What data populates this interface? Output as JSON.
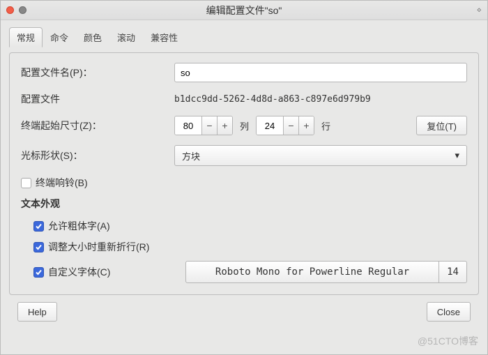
{
  "window": {
    "title": "编辑配置文件\"so\""
  },
  "tabs": [
    "常规",
    "命令",
    "颜色",
    "滚动",
    "兼容性"
  ],
  "form": {
    "profile_name": {
      "label": "配置文件名(P)：",
      "value": "so"
    },
    "profile_id": {
      "label": "配置文件",
      "value": "b1dcc9dd-5262-4d8d-a863-c897e6d979b9"
    },
    "initial_size": {
      "label": "终端起始尺寸(Z)：",
      "cols": "80",
      "cols_unit": "列",
      "rows": "24",
      "rows_unit": "行",
      "reset_label": "复位(T)"
    },
    "cursor_shape": {
      "label": "光标形状(S)：",
      "value": "方块"
    },
    "terminal_bell": {
      "label": "终端响铃(B)",
      "checked": false
    },
    "text_appearance": {
      "heading": "文本外观",
      "allow_bold": "允许粗体字(A)",
      "rewrap_on_resize": "调整大小时重新折行(R)",
      "custom_font_label": "自定义字体(C)",
      "font_name": "Roboto Mono for Powerline Regular",
      "font_size": "14"
    }
  },
  "footer": {
    "help": "Help",
    "close": "Close"
  },
  "watermark": "@51CTO博客"
}
